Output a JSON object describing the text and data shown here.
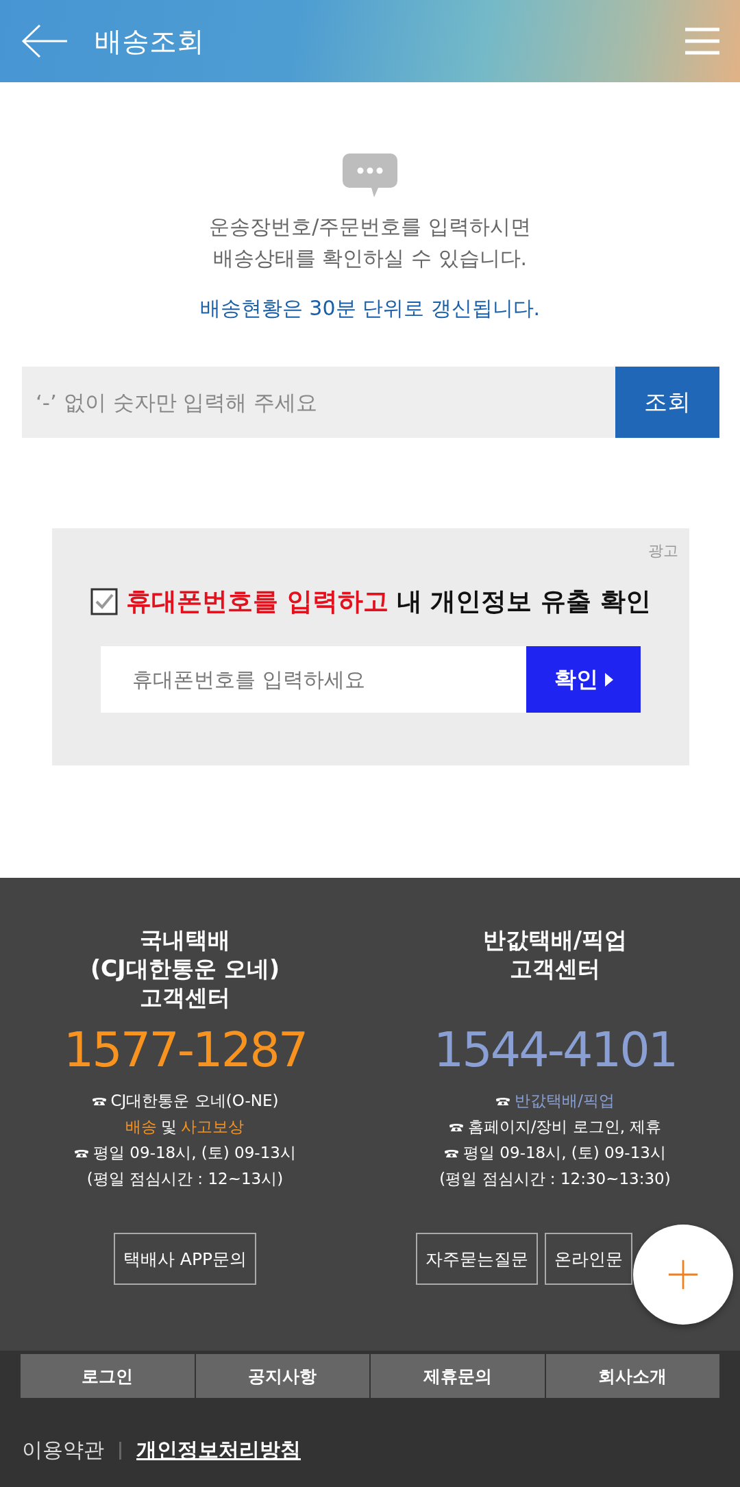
{
  "header": {
    "title": "배송조회"
  },
  "intro": {
    "lines": [
      "운송장번호/주문번호를 입력하시면",
      "배송상태를 확인하실 수 있습니다."
    ],
    "notice": "배송현황은 30분 단위로 갱신됩니다."
  },
  "search": {
    "placeholder": "‘-’ 없이 숫자만 입력해 주세요",
    "button": "조회"
  },
  "ad": {
    "label": "광고",
    "checked": true,
    "headline": [
      {
        "text": "휴대폰번호를 입력하고",
        "highlight": true
      },
      {
        "text": "내 개인정보 유출 확인",
        "highlight": false
      }
    ],
    "placeholder": "휴대폰번호를 입력하세요",
    "button": "확인"
  },
  "centers": [
    {
      "title_lines": [
        "국내택배",
        "(CJ대한통운 오네)",
        "고객센터"
      ],
      "number": "1577-1287",
      "color": "#f7931e",
      "info": [
        {
          "phone": true,
          "parts": [
            {
              "text": "CJ대한통운 오네(O-NE)",
              "highlight": false
            }
          ]
        },
        {
          "phone": false,
          "parts": [
            {
              "text": "배송",
              "highlight": true
            },
            {
              "text": "및",
              "highlight": false
            },
            {
              "text": "사고보상",
              "highlight": true
            }
          ]
        },
        {
          "phone": true,
          "parts": [
            {
              "text": "평일 09-18시, (토) 09-13시",
              "highlight": false
            }
          ]
        },
        {
          "phone": false,
          "parts": [
            {
              "text": "(평일 점심시간 : 12~13시)",
              "highlight": false
            }
          ]
        }
      ],
      "buttons": [
        "택배사 APP문의"
      ]
    },
    {
      "title_lines": [
        "반값택배/픽업",
        "고객센터"
      ],
      "number": "1544-4101",
      "color": "#8a9fd4",
      "info": [
        {
          "phone": true,
          "parts": [
            {
              "text": "반값택배/픽업",
              "highlight": true
            }
          ]
        },
        {
          "phone": true,
          "parts": [
            {
              "text": "홈페이지/장비 로그인, 제휴",
              "highlight": false
            }
          ]
        },
        {
          "phone": true,
          "parts": [
            {
              "text": "평일 09-18시, (토) 09-13시",
              "highlight": false
            }
          ]
        },
        {
          "phone": false,
          "parts": [
            {
              "text": "(평일 점심시간 : 12:30~13:30)",
              "highlight": false
            }
          ]
        }
      ],
      "buttons": [
        "자주묻는질문",
        "온라인문"
      ]
    }
  ],
  "nav": [
    "로그인",
    "공지사항",
    "제휴문의",
    "회사소개"
  ],
  "links": [
    {
      "text": "이용약관",
      "emphasis": false
    },
    {
      "text": "개인정보처리방침",
      "emphasis": true
    }
  ]
}
